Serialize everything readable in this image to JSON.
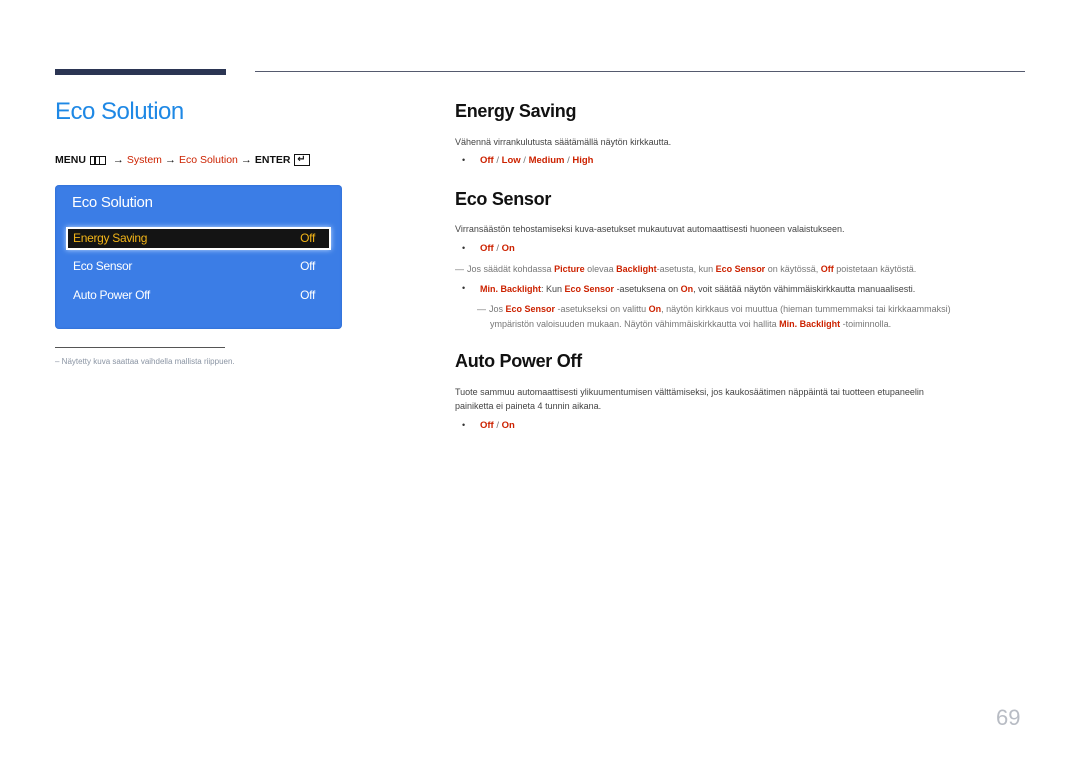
{
  "header": {
    "page_title": "Eco Solution"
  },
  "menu_path": {
    "menu": "MENU",
    "arrow": "→",
    "step1": "System",
    "step2": "Eco Solution",
    "enter": "ENTER",
    "menu_icon": "menu-grid-icon",
    "enter_icon": "enter-icon"
  },
  "osd": {
    "title": "Eco Solution",
    "rows": [
      {
        "label": "Energy Saving",
        "value": "Off",
        "selected": true
      },
      {
        "label": "Eco Sensor",
        "value": "Off",
        "selected": false
      },
      {
        "label": "Auto Power Off",
        "value": "Off",
        "selected": false
      }
    ],
    "colors": {
      "background": "#3b7de6",
      "selected_text": "#f2b418"
    }
  },
  "footnote": "– Näytetty kuva saattaa vaihdella mallista riippuen.",
  "sections": {
    "energy_saving": {
      "title": "Energy Saving",
      "description": "Vähennä virrankulutusta säätämällä näytön kirkkautta.",
      "options": [
        "Off",
        "Low",
        "Medium",
        "High"
      ]
    },
    "eco_sensor": {
      "title": "Eco Sensor",
      "description": "Virransäästön tehostamiseksi kuva-asetukset mukautuvat automaattisesti huoneen valaistukseen.",
      "options": [
        "Off",
        "On"
      ],
      "note1": {
        "t1": "Jos säädät kohdassa ",
        "b1": "Picture",
        "t2": " olevaa ",
        "b2": "Backlight",
        "t3": "-asetusta, kun ",
        "b3": "Eco Sensor",
        "t4": " on käytössä, ",
        "b4": "Off",
        "t5": " poistetaan käytöstä."
      },
      "min_backlight": {
        "b1": "Min. Backlight",
        "t1": ": Kun ",
        "b2": "Eco Sensor",
        "t2": " -asetuksena on ",
        "b3": "On",
        "t3": ", voit säätää näytön vähimmäiskirkkautta manuaalisesti."
      },
      "note2": {
        "t1": "Jos ",
        "b1": "Eco Sensor",
        "t2": " -asetukseksi on valittu ",
        "b2": "On",
        "t3": ", näytön kirkkaus voi muuttua (hieman tummemmaksi tai kirkkaammaksi)",
        "t4": "ympäristön valoisuuden mukaan. Näytön vähimmäiskirkkautta voi hallita ",
        "b3": "Min. Backlight",
        "t5": " -toiminnolla."
      }
    },
    "auto_power_off": {
      "title": "Auto Power Off",
      "description_line1": "Tuote sammuu automaattisesti ylikuumentumisen välttämiseksi, jos kaukosäätimen näppäintä tai tuotteen etupaneelin",
      "description_line2": "painiketta ei paineta 4 tunnin aikana.",
      "options": [
        "Off",
        "On"
      ]
    }
  },
  "page_number": "69",
  "colors": {
    "accent_blue": "#1e88e5",
    "option_red": "#cc2200",
    "bar_navy": "#2b3553"
  }
}
